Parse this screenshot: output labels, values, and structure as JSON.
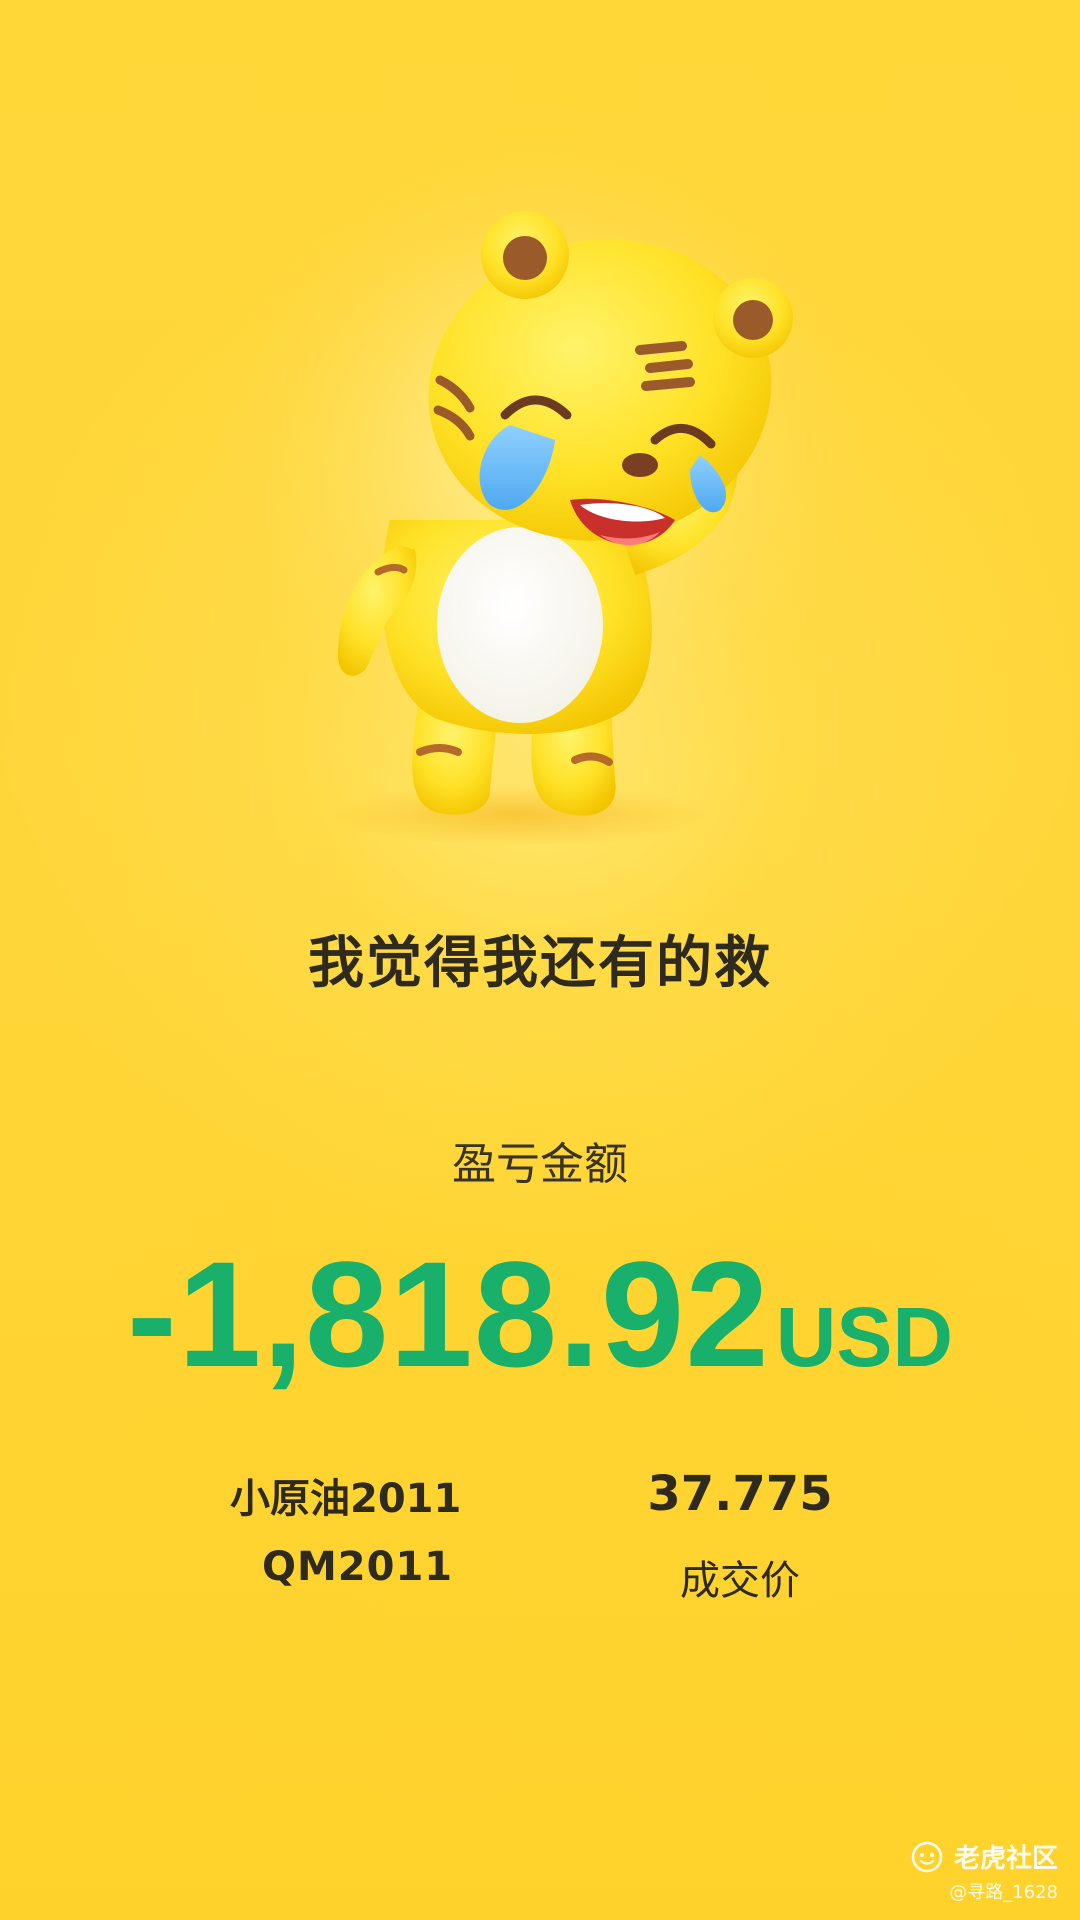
{
  "mood": {
    "message": "我觉得我还有的救"
  },
  "pnl": {
    "label": "盈亏金额",
    "amount": "-1,818.92",
    "currency": "USD"
  },
  "contract": {
    "name": "小原油2011",
    "code": "QM2011"
  },
  "price": {
    "value": "37.775",
    "label": "成交价"
  },
  "watermark": {
    "brand": "老虎社区",
    "user": "@寻路_1628"
  },
  "colors": {
    "background": "#ffd63a",
    "pnl_text": "#18b06a",
    "primary_text": "#2f2a1e"
  },
  "icons": {
    "mascot": "crying-tiger-mascot",
    "watermark_logo": "tiger-community-logo-icon"
  }
}
